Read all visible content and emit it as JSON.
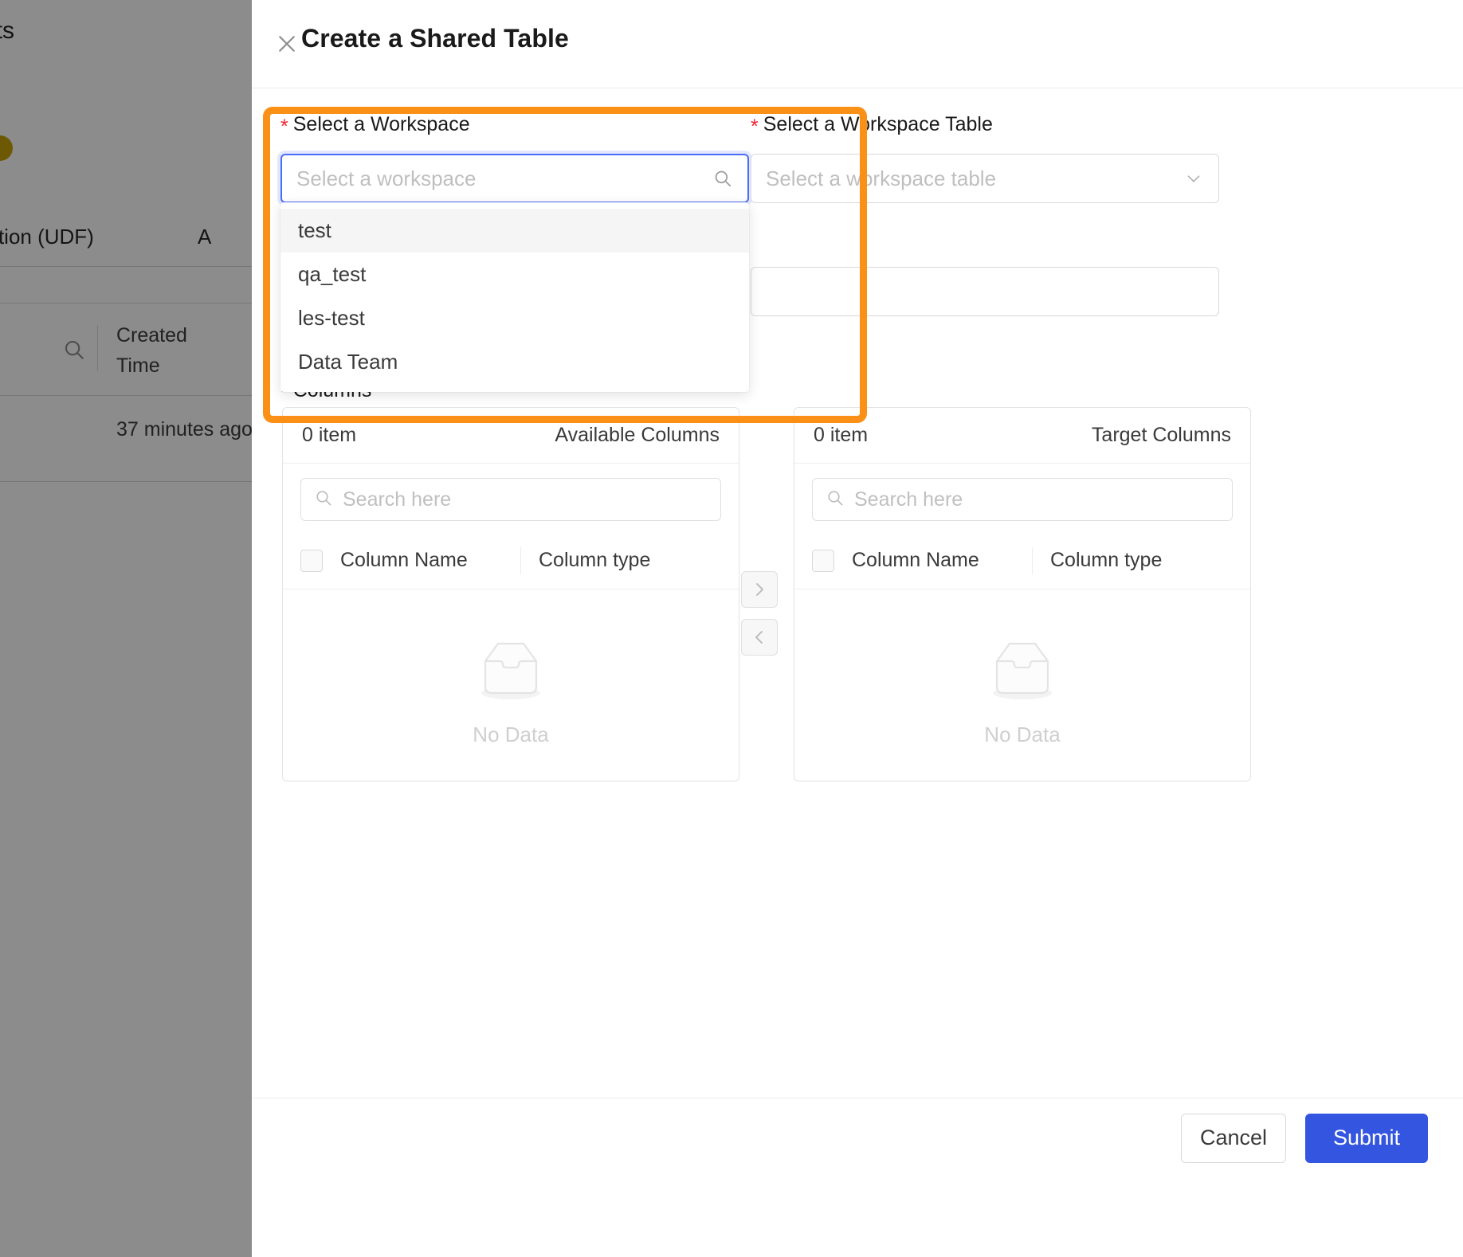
{
  "background": {
    "page_title": "tasets",
    "udf_tab": "ed Function (UDF)",
    "other_tab": "A",
    "column_header": "Created Time",
    "cell_value": "37 minutes ago",
    "search_icon": "search-icon"
  },
  "dialog": {
    "title": "Create a Shared Table",
    "close_icon": "close-icon",
    "highlight_color": "#FA9016",
    "accent_color": "#3355e0",
    "required_marker": "*",
    "workspace": {
      "label": "Select a Workspace",
      "placeholder": "Select a workspace",
      "value": "",
      "search_icon": "search-icon",
      "options": [
        {
          "label": "test",
          "active": true
        },
        {
          "label": "qa_test",
          "active": false
        },
        {
          "label": "les-test",
          "active": false
        },
        {
          "label": "Data Team",
          "active": false
        }
      ]
    },
    "workspace_table": {
      "label": "Select a Workspace Table",
      "placeholder": "Select a workspace table",
      "value": "",
      "chevron_icon": "chevron-down-icon"
    },
    "columns": {
      "label": "Columns",
      "available": {
        "count_label": "0 item",
        "title": "Available Columns",
        "search_placeholder": "Search here",
        "search_icon": "search-icon",
        "col_name_header": "Column Name",
        "col_type_header": "Column type",
        "empty_label": "No Data",
        "empty_icon": "inbox-icon",
        "rows": []
      },
      "target": {
        "count_label": "0 item",
        "title": "Target Columns",
        "search_placeholder": "Search here",
        "search_icon": "search-icon",
        "col_name_header": "Column Name",
        "col_type_header": "Column type",
        "empty_label": "No Data",
        "empty_icon": "inbox-icon",
        "rows": []
      },
      "move_right_icon": ">",
      "move_left_icon": "<"
    },
    "footer": {
      "cancel_label": "Cancel",
      "submit_label": "Submit"
    }
  }
}
